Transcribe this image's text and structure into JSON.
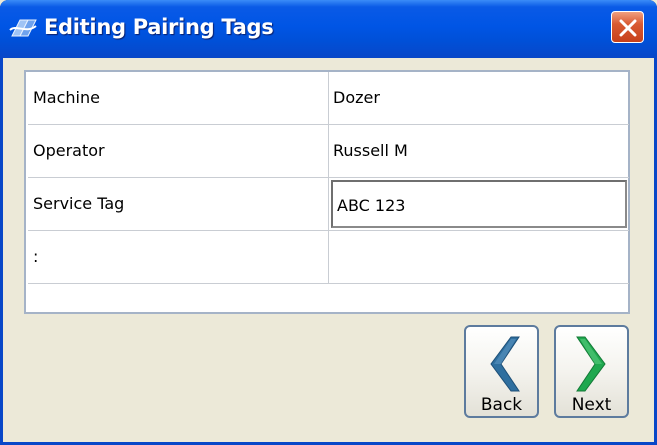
{
  "window": {
    "title": "Editing Pairing Tags",
    "icon": "app-logo-icon",
    "close_icon": "close-icon"
  },
  "tags": [
    {
      "key": "Machine",
      "value": "Dozer"
    },
    {
      "key": "Operator",
      "value": "Russell M"
    },
    {
      "key": "Service Tag",
      "value": "ABC 123",
      "editing": true
    },
    {
      "key": ":",
      "value": ""
    }
  ],
  "nav": {
    "back_label": "Back",
    "next_label": "Next",
    "back_icon": "chevron-left-icon",
    "next_icon": "chevron-right-icon"
  },
  "colors": {
    "titlebar": "#0055E5",
    "back_arrow": "#2F6F9F",
    "next_arrow": "#1FA84F",
    "close": "#D95A32"
  }
}
